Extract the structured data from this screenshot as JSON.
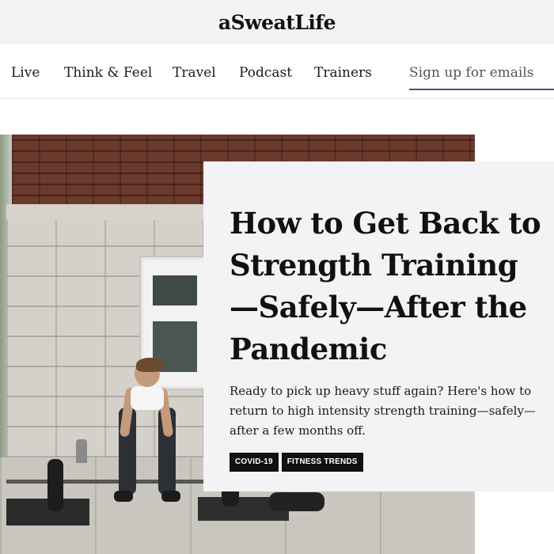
{
  "header": {
    "logo": "aSweatLife"
  },
  "nav": {
    "items": [
      "Live",
      "Think & Feel",
      "Travel",
      "Podcast",
      "Trainers"
    ],
    "signup": "Sign up for emails"
  },
  "article": {
    "title": "How to Get Back to Strength Training—Safely—After the Pandemic",
    "dek": "Ready to pick up heavy stuff again? Here's how to return to high intensity strength training—safely—after a few months off.",
    "tags": [
      "COVID-19",
      "FITNESS TRENDS"
    ]
  },
  "colors": {
    "nav_underline": "#5a4c7a",
    "card_bg": "#f3f2f5",
    "tag_bg": "#111111"
  }
}
